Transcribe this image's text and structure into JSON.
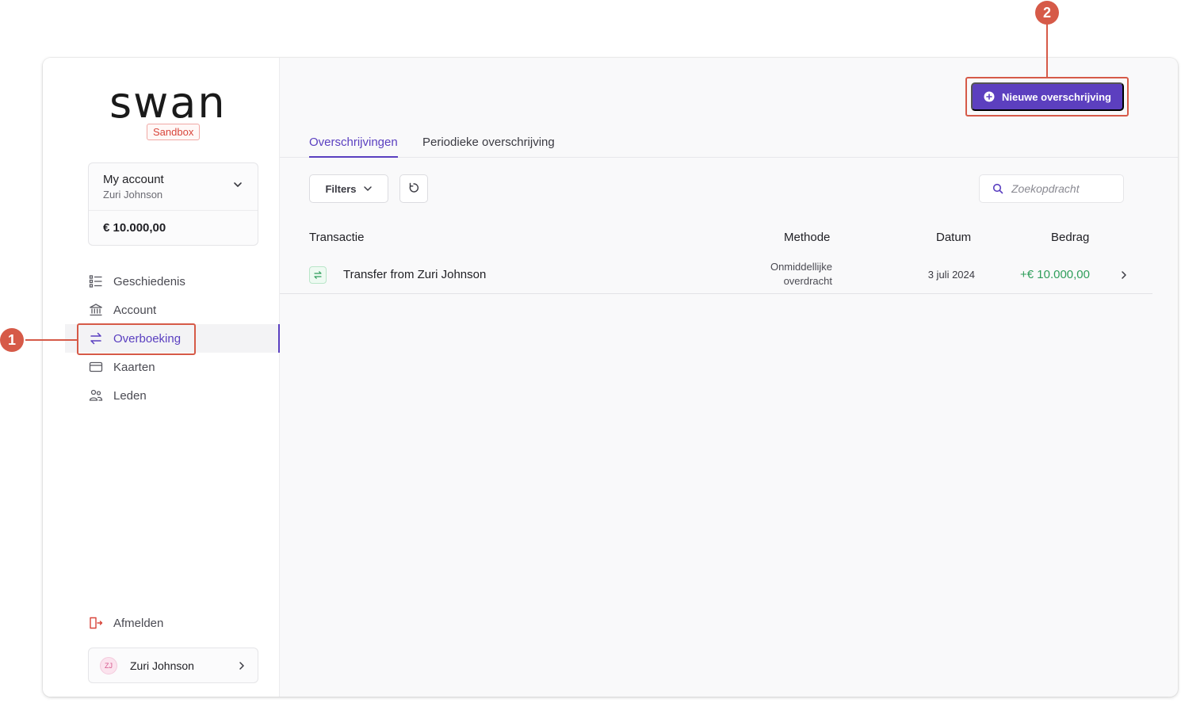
{
  "sidebar": {
    "logo": "swan",
    "env_badge": "Sandbox",
    "account": {
      "title": "My account",
      "owner": "Zuri Johnson",
      "balance": "€ 10.000,00"
    },
    "nav": [
      {
        "label": "Geschiedenis",
        "icon": "list-icon"
      },
      {
        "label": "Account",
        "icon": "bank-icon"
      },
      {
        "label": "Overboeking",
        "icon": "transfer-icon",
        "active": true
      },
      {
        "label": "Kaarten",
        "icon": "card-icon"
      },
      {
        "label": "Leden",
        "icon": "members-icon"
      }
    ],
    "logout_label": "Afmelden",
    "user": {
      "initials": "ZJ",
      "name": "Zuri Johnson"
    }
  },
  "main": {
    "new_button_label": "Nieuwe overschrijving",
    "tabs": [
      {
        "label": "Overschrijvingen",
        "active": true
      },
      {
        "label": "Periodieke overschrijving",
        "active": false
      }
    ],
    "filters_label": "Filters",
    "search_placeholder": "Zoekopdracht",
    "table": {
      "headers": {
        "transaction": "Transactie",
        "method": "Methode",
        "date": "Datum",
        "amount": "Bedrag"
      },
      "rows": [
        {
          "name": "Transfer from Zuri Johnson",
          "method_line1": "Onmiddellijke",
          "method_line2": "overdracht",
          "date": "3 juli 2024",
          "amount": "+€ 10.000,00"
        }
      ]
    }
  },
  "callouts": [
    "1",
    "2"
  ],
  "colors": {
    "accent": "#5c3fbf",
    "positive": "#2f9e5b",
    "callout": "#d65a48",
    "sandbox": "#d8453b"
  }
}
